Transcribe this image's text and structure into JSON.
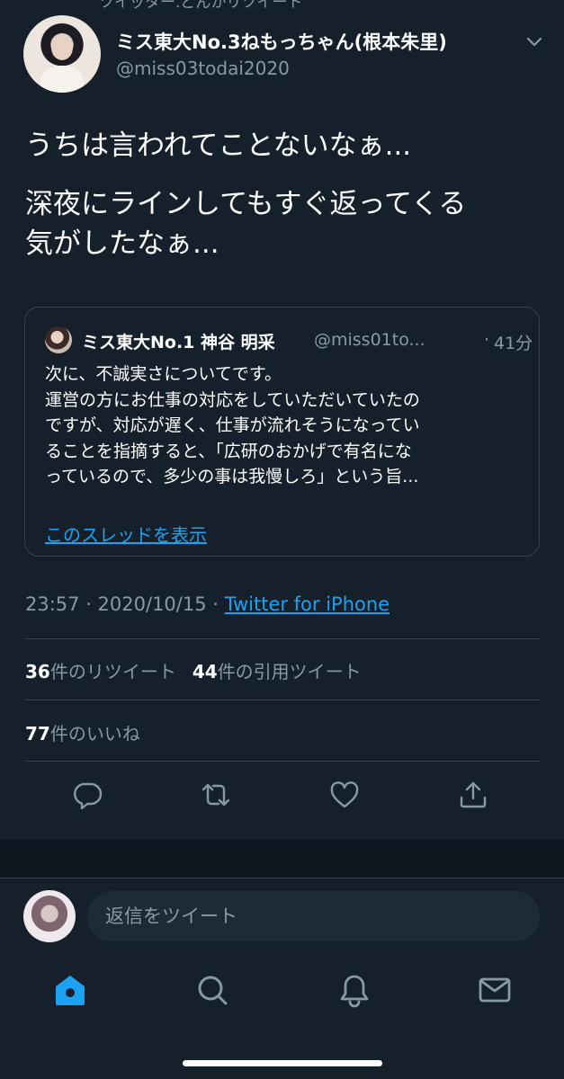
{
  "tweet": {
    "social_context": "ツイッター.どんかリツイート",
    "author": {
      "display_name": "ミス東大No.3ねもっちゃん(根本朱里)",
      "handle": "@miss03todai2020"
    },
    "text_lines": [
      "うちは言われてことないなぁ...",
      "深夜にラインしてもすぐ返ってくる",
      "気がしたなぁ..."
    ],
    "quoted": {
      "display_name": "ミス東大No.1 神谷 明采",
      "handle": "@miss01to...",
      "separator": "·",
      "time": "41分",
      "body_lines": [
        "次に、不誠実さについてです。",
        "運営の方にお仕事の対応をしていただいていたの",
        "ですが、対応が遅く、仕事が流れそうになってい",
        "ることを指摘すると、「広研のおかげで有名にな",
        "っているので、多少の事は我慢しろ」という旨..."
      ],
      "show_thread": "このスレッドを表示"
    },
    "timestamp": "23:57 · 2020/10/15 · ",
    "source": "Twitter for iPhone",
    "stats": {
      "retweet_count": "36",
      "retweet_label": "件のリツイート",
      "quote_count": "44",
      "quote_label": "件の引用ツイート",
      "like_count": "77",
      "like_label": "件のいいね"
    }
  },
  "reply": {
    "placeholder": "返信をツイート"
  },
  "actions": [
    "reply-icon",
    "retweet-icon",
    "like-icon",
    "share-icon"
  ],
  "tabs": [
    "home-icon",
    "search-icon",
    "notifications-icon",
    "messages-icon"
  ],
  "colors": {
    "background": "#15202b",
    "accent": "#1da1f2",
    "secondary_text": "#8899a6",
    "border": "#38444d"
  }
}
